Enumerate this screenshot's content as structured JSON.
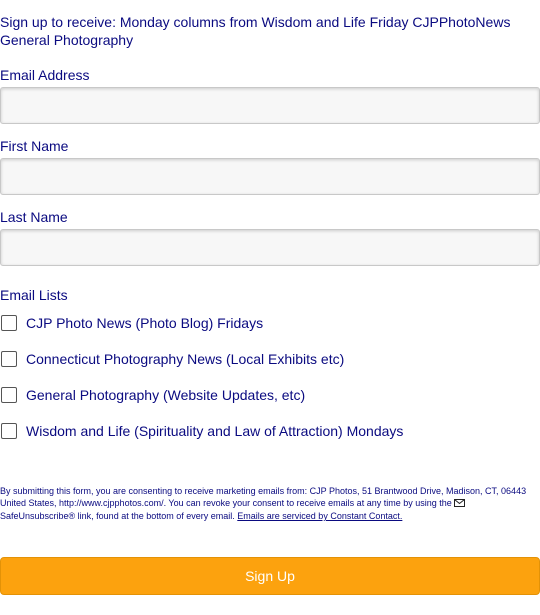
{
  "form": {
    "intro": "Sign up to receive: Monday columns from Wisdom and Life Friday CJPPhotoNews General Photography",
    "fields": {
      "email_label": "Email Address",
      "email_value": "",
      "first_name_label": "First Name",
      "first_name_value": "",
      "last_name_label": "Last Name",
      "last_name_value": ""
    },
    "lists": {
      "label": "Email Lists",
      "items": [
        {
          "label": "CJP Photo News (Photo Blog) Fridays",
          "checked": false
        },
        {
          "label": "Connecticut Photography News (Local Exhibits etc)",
          "checked": false
        },
        {
          "label": "General Photography (Website Updates, etc)",
          "checked": false
        },
        {
          "label": "Wisdom and Life (Spirituality and Law of Attraction) Mondays",
          "checked": false
        }
      ]
    },
    "consent": {
      "text_before_icon": "By submitting this form, you are consenting to receive marketing emails from: CJP Photos, 51 Brantwood Drive, Madison, CT, 06443 United States, http://www.cjpphotos.com/. You can revoke your consent to receive emails at any time by using the",
      "text_after_icon": "SafeUnsubscribe® link, found at the bottom of every email.",
      "link_text": "Emails are serviced by Constant Contact.",
      "icon": "envelope-icon"
    },
    "submit_label": "Sign Up"
  },
  "colors": {
    "text": "#0a0a80",
    "button": "#fca20e",
    "input_background": "#f7f7f7"
  }
}
